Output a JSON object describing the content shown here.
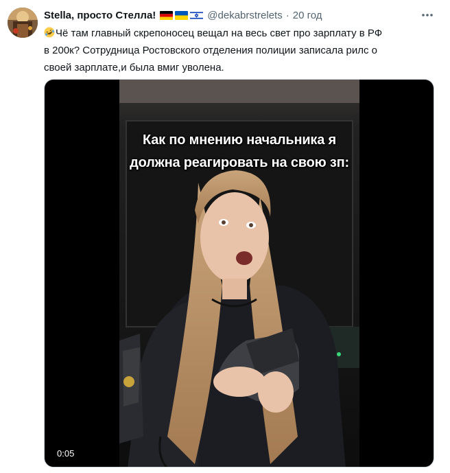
{
  "tweet": {
    "author_name": "Stella, просто Стелла!",
    "flags": [
      "flag-germany-icon",
      "flag-ukraine-icon",
      "flag-israel-icon"
    ],
    "handle": "@dekabrstrelets",
    "separator": "·",
    "timestamp": "20 год",
    "more_icon": "more-horizontal-icon",
    "text_lines": [
      "Чё там главный скрепоносец вещал на весь свет про зарплату в РФ",
      "в 200к? Сотрудница Ростовского отделения полиции записала рилс о",
      "своей зарплате,и была  вмиг уволена."
    ],
    "leading_emoji": "rofl-emoji-icon"
  },
  "video": {
    "caption_line1": "Как по мнению начальника я",
    "caption_line2": "должна реагировать на свою зп:",
    "duration": "0:05"
  },
  "colors": {
    "text": "#0f1419",
    "secondary": "#536471",
    "border": "#cfd9de",
    "media_bg": "#000000"
  }
}
